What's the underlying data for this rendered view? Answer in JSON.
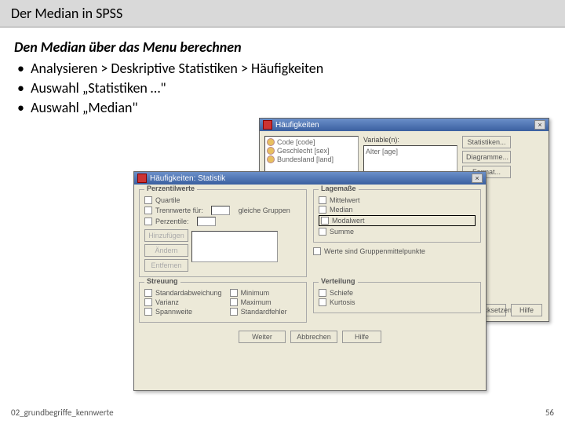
{
  "slide": {
    "title": "Der Median in SPSS",
    "heading": "Den Median über das Menu berechnen",
    "bullets": [
      "Analysieren > Deskriptive Statistiken > Häufigkeiten",
      "Auswahl „Statistiken …\"",
      "Auswahl „Median\""
    ],
    "footer_left": "02_grundbegriffe_kennwerte",
    "footer_right": "56"
  },
  "dlg1": {
    "title": "Häufigkeiten",
    "vars": [
      "Code [code]",
      "Geschlecht [sex]",
      "Bundesland [land]"
    ],
    "target_label": "Variable(n):",
    "target_item": "Alter [age]",
    "buttons": {
      "stat": "Statistiken...",
      "diag": "Diagramme...",
      "format": "Format..."
    },
    "bottom": {
      "reset": "Zurücksetzen",
      "help": "Hilfe"
    }
  },
  "dlg2": {
    "title": "Häufigkeiten: Statistik",
    "close": "×",
    "groups": {
      "perzentile": "Perzentilwerte",
      "lage": "Lagemaße",
      "streuung": "Streuung",
      "verteilung": "Verteilung"
    },
    "perz": {
      "quartile": "Quartile",
      "trennwerte": "Trennwerte für:",
      "gruppen": "gleiche Gruppen",
      "perzentile": "Perzentile:",
      "hinzu": "Hinzufügen",
      "aendern": "Ändern",
      "entfernen": "Entfernen"
    },
    "lage": {
      "mittelwert": "Mittelwert",
      "median": "Median",
      "modalwert": "Modalwert",
      "summe": "Summe",
      "mittelpunkte": "Werte sind Gruppenmittelpunkte"
    },
    "streuung": {
      "std": "Standardabweichung",
      "varianz": "Varianz",
      "spannweite": "Spannweite",
      "min": "Minimum",
      "max": "Maximum",
      "stderr": "Standardfehler"
    },
    "verteilung": {
      "schiefe": "Schiefe",
      "kurtosis": "Kurtosis"
    },
    "btns": {
      "weiter": "Weiter",
      "abbrechen": "Abbrechen",
      "hilfe": "Hilfe"
    }
  }
}
